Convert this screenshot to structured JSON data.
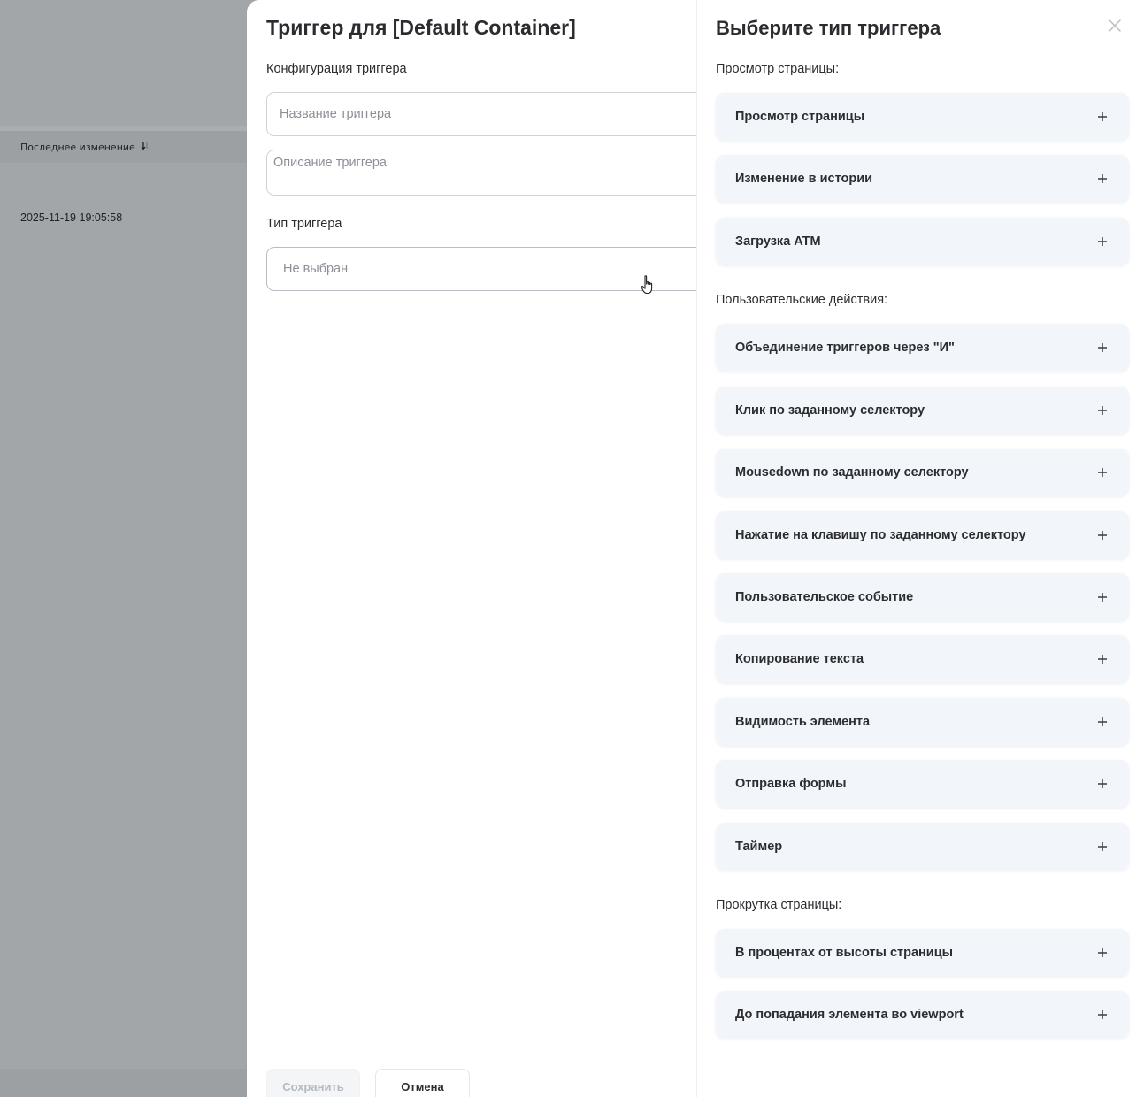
{
  "background": {
    "column_header": "Последнее изменение",
    "row_date": "2025-11-19 19:05:58"
  },
  "form": {
    "title": "Триггер для [Default Container]",
    "config_label": "Конфигурация триггера",
    "name_placeholder": "Название триггера",
    "description_placeholder": "Описание триггера",
    "type_label": "Тип триггера",
    "type_value": "Не выбран",
    "save_label": "Сохранить",
    "cancel_label": "Отмена"
  },
  "type_panel": {
    "title": "Выберите тип триггера",
    "groups": [
      {
        "label": "Просмотр страницы:",
        "items": [
          "Просмотр страницы",
          "Изменение в истории",
          "Загрузка ATM"
        ]
      },
      {
        "label": "Пользовательские действия:",
        "items": [
          "Объединение триггеров через \"И\"",
          "Клик по заданному селектору",
          "Mousedown по заданному селектору",
          "Нажатие на клавишу по заданному селектору",
          "Пользовательское событие",
          "Копирование текста",
          "Видимость элемента",
          "Отправка формы",
          "Таймер"
        ]
      },
      {
        "label": "Прокрутка страницы:",
        "items": [
          "В процентах от высоты страницы",
          "До попадания элемента во viewport"
        ]
      }
    ]
  },
  "icons": {
    "close": "close-icon",
    "add": "plus-icon",
    "sort": "sort-arrow-icon",
    "pointer": "hand-cursor-icon"
  }
}
